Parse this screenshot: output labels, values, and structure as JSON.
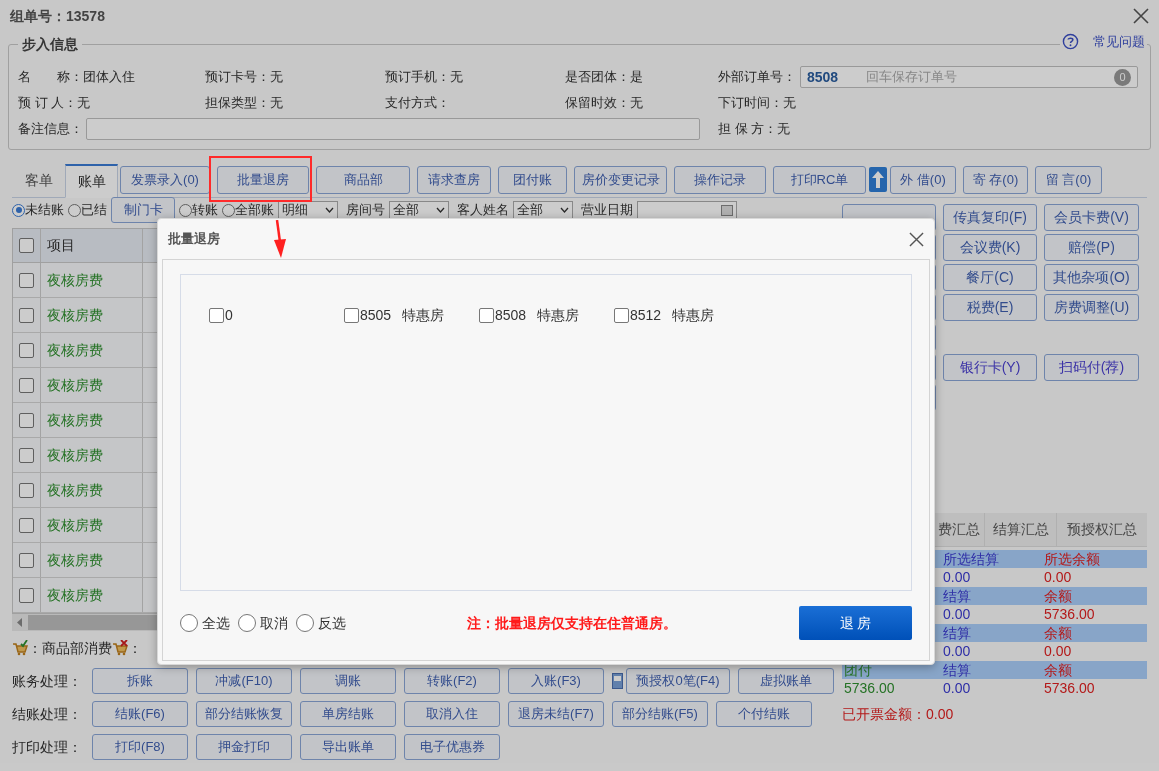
{
  "window": {
    "title": "组单号：13578"
  },
  "help_link": "常见问题",
  "section_title": "步入信息",
  "info": {
    "row1": [
      {
        "label": "名　　称：",
        "value": "团体入住"
      },
      {
        "label": "预订卡号：",
        "value": "无"
      },
      {
        "label": "预订手机：",
        "value": "无"
      },
      {
        "label": "是否团体：",
        "value": "是"
      }
    ],
    "external_order": {
      "label": "外部订单号：",
      "value": "8508",
      "placeholder": "回车保存订单号",
      "badge": "0"
    },
    "row2": [
      {
        "label": "预 订 人：",
        "value": "无"
      },
      {
        "label": "担保类型：",
        "value": "无"
      },
      {
        "label": "支付方式："
      },
      {
        "label": "保留时效：",
        "value": "无"
      },
      {
        "label": "下订时间：",
        "value": "无"
      }
    ],
    "remark_label": "备注信息：",
    "guarantor": {
      "label": "担 保 方：",
      "value": "无"
    }
  },
  "tabs": [
    {
      "label": "客单",
      "selected": false
    },
    {
      "label": "账单",
      "selected": true
    }
  ],
  "toolbar": [
    {
      "kind": "button",
      "label": "发票录入(0)",
      "annotated": false
    },
    {
      "kind": "button",
      "label": "批量退房",
      "annotated": true
    },
    {
      "kind": "button",
      "label": "商品部",
      "annotated": false
    },
    {
      "kind": "button",
      "label": "请求查房",
      "annotated": false
    },
    {
      "kind": "button",
      "label": "团付账",
      "annotated": false
    },
    {
      "kind": "button",
      "label": "房价变更记录",
      "annotated": false
    },
    {
      "kind": "button",
      "label": "操作记录",
      "annotated": false
    },
    {
      "kind": "button",
      "label": "打印RC单",
      "annotated": false
    },
    {
      "kind": "upload"
    },
    {
      "kind": "button",
      "label": "外 借(0)",
      "annotated": false
    },
    {
      "kind": "button",
      "label": "寄 存(0)",
      "annotated": false
    },
    {
      "kind": "button",
      "label": "留 言(0)",
      "annotated": false
    }
  ],
  "filter": [
    {
      "kind": "radio",
      "label": "未结账",
      "selected": true
    },
    {
      "kind": "radio",
      "label": "已结",
      "selected": false
    },
    {
      "kind": "button",
      "label": "制门卡"
    },
    {
      "kind": "radio",
      "label": "转账",
      "selected": false
    },
    {
      "kind": "radio",
      "label": "全部账",
      "selected": false
    },
    {
      "kind": "select",
      "value": "明细"
    },
    {
      "kind": "label",
      "text": "房间号"
    },
    {
      "kind": "select",
      "value": "全部"
    },
    {
      "kind": "label",
      "text": "客人姓名"
    },
    {
      "kind": "select",
      "value": "全部"
    },
    {
      "kind": "label",
      "text": "营业日期"
    },
    {
      "kind": "date"
    }
  ],
  "table": {
    "header_checked": false,
    "columns": [
      "项目"
    ],
    "rows": [
      {
        "checked": false,
        "cells": [
          "夜核房费"
        ]
      },
      {
        "checked": false,
        "cells": [
          "夜核房费"
        ]
      },
      {
        "checked": false,
        "cells": [
          "夜核房费"
        ]
      },
      {
        "checked": false,
        "cells": [
          "夜核房费"
        ]
      },
      {
        "checked": false,
        "cells": [
          "夜核房费"
        ]
      },
      {
        "checked": false,
        "cells": [
          "夜核房费"
        ]
      },
      {
        "checked": false,
        "cells": [
          "夜核房费"
        ]
      },
      {
        "checked": false,
        "cells": [
          "夜核房费"
        ]
      },
      {
        "checked": false,
        "cells": [
          "夜核房费"
        ]
      },
      {
        "checked": false,
        "cells": [
          "夜核房费"
        ]
      }
    ]
  },
  "legend": [
    {
      "kind": "cart",
      "text": "：商品部消费"
    },
    {
      "kind": "cart-x",
      "text": "："
    }
  ],
  "actions": [
    {
      "label": "账务处理：",
      "buttons": [
        {
          "kind": "button",
          "label": "拆账"
        },
        {
          "kind": "button",
          "label": "冲减(F10)"
        },
        {
          "kind": "button",
          "label": "调账"
        },
        {
          "kind": "button",
          "label": "转账(F2)"
        },
        {
          "kind": "button",
          "label": "入账(F3)"
        },
        {
          "kind": "icon-button",
          "label": "预授权0笔(F4)"
        },
        {
          "kind": "button",
          "label": "虚拟账单"
        }
      ]
    },
    {
      "label": "结账处理：",
      "buttons": [
        {
          "kind": "button",
          "label": "结账(F6)"
        },
        {
          "kind": "button",
          "label": "部分结账恢复"
        },
        {
          "kind": "button",
          "label": "单房结账"
        },
        {
          "kind": "button",
          "label": "取消入住"
        },
        {
          "kind": "button",
          "label": "退房未结(F7)"
        },
        {
          "kind": "button",
          "label": "部分结账(F5)"
        },
        {
          "kind": "button",
          "label": "个付结账"
        }
      ]
    },
    {
      "label": "打印处理：",
      "buttons": [
        {
          "kind": "button",
          "label": "打印(F8)"
        },
        {
          "kind": "button",
          "label": "押金打印"
        },
        {
          "kind": "button",
          "label": "导出账单"
        },
        {
          "kind": "button",
          "label": "电子优惠券"
        }
      ]
    }
  ],
  "side_buttons": [
    {
      "kind": "charge",
      "cells": [
        "传真复印(F)",
        "会员卡费(V)"
      ]
    },
    {
      "kind": "charge",
      "cells": [
        "会议费(K)",
        "赔偿(P)"
      ]
    },
    {
      "kind": "charge",
      "cells": [
        "餐厅(C)",
        "其他杂项(O)"
      ]
    },
    {
      "kind": "charge",
      "cells": [
        "税费(E)",
        "房费调整(U)"
      ]
    },
    {
      "kind": "payment",
      "cells": [
        "银行卡(Y)",
        "扫码付(荐)"
      ]
    }
  ],
  "summary": {
    "tabs": [
      "费汇总",
      "结算汇总",
      "预授权汇总"
    ],
    "blocks": [
      {
        "header": {
          "settled": "所选结算",
          "balance": "所选余额"
        },
        "values": {
          "settled": "0.00",
          "balance": "0.00"
        }
      },
      {
        "header": {
          "settled": "结算",
          "balance": "余额"
        },
        "values": {
          "settled": "0.00",
          "balance": "5736.00"
        }
      },
      {
        "header": {
          "settled": "结算",
          "balance": "余额"
        },
        "values": {
          "settled": "0.00",
          "balance": "0.00"
        }
      },
      {
        "header": {
          "name": "团付",
          "settled": "结算",
          "balance": "余额"
        },
        "values": {
          "name": "5736.00",
          "settled": "0.00",
          "balance": "5736.00"
        }
      }
    ],
    "invoiced": "已开票金额：0.00"
  },
  "dialog": {
    "title": "批量退房",
    "rooms": [
      {
        "number": "0",
        "checked": false
      },
      {
        "number": "8505",
        "type": "特惠房",
        "checked": false
      },
      {
        "number": "8508",
        "type": "特惠房",
        "checked": false
      },
      {
        "number": "8512",
        "type": "特惠房",
        "checked": false
      }
    ],
    "radios": [
      {
        "label": "全选",
        "selected": false
      },
      {
        "label": "取消",
        "selected": false
      },
      {
        "label": "反选",
        "selected": false
      }
    ],
    "note": "注：批量退房仅支持在住普通房。",
    "confirm": "退 房"
  }
}
